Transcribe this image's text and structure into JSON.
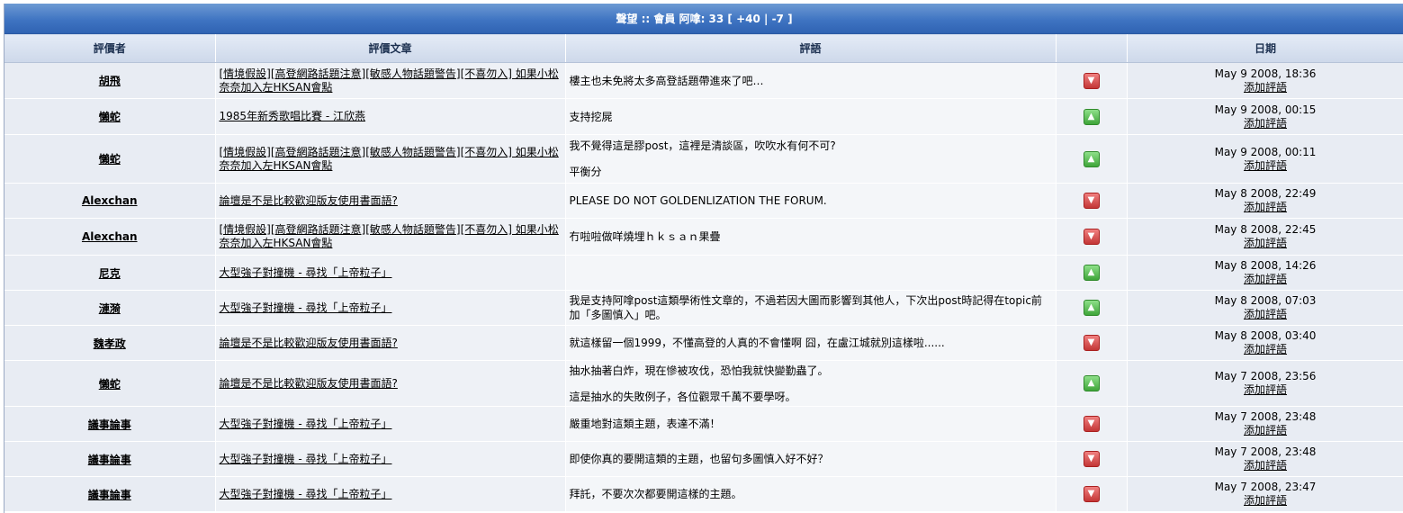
{
  "title": "聲望 :: 會員 阿嗱: 33 [ +40 | -7 ]",
  "headers": {
    "rater": "評價者",
    "article": "評價文章",
    "comment": "評語",
    "rating": "",
    "date": "日期"
  },
  "colors": {
    "up": "#3fa53a",
    "down": "#c33636",
    "header": "#3f74c2"
  },
  "rows": [
    {
      "user": "胡飛",
      "topic": "[情境假設][高登網路話題注意][敏感人物話題警告][不喜勿入] 如果小松奈奈加入左HKSAN會點",
      "comment": [
        "樓主也未免將太多高登話題帶進來了吧…"
      ],
      "rating": "down",
      "rating_icon": "thumb-down-icon",
      "date": "May 9 2008, 18:36",
      "add": "添加評語"
    },
    {
      "user": "懶蛇",
      "topic": "1985年新秀歌唱比賽 - 江欣燕",
      "comment": [
        "支持挖屍"
      ],
      "rating": "up",
      "rating_icon": "thumb-up-icon",
      "date": "May 9 2008, 00:15",
      "add": "添加評語"
    },
    {
      "user": "懶蛇",
      "topic": "[情境假設][高登網路話題注意][敏感人物話題警告][不喜勿入] 如果小松奈奈加入左HKSAN會點",
      "comment": [
        "我不覺得這是膠post，這裡是清談區，吹吹水有何不可?",
        "平衡分"
      ],
      "rating": "up",
      "rating_icon": "thumb-up-icon",
      "date": "May 9 2008, 00:11",
      "add": "添加評語"
    },
    {
      "user": "Alexchan",
      "topic": "論壇是不是比較歡迎版友使用書面語?",
      "comment": [
        "PLEASE DO NOT GOLDENLIZATION THE FORUM."
      ],
      "rating": "down",
      "rating_icon": "thumb-down-icon",
      "date": "May 8 2008, 22:49",
      "add": "添加評語"
    },
    {
      "user": "Alexchan",
      "topic": "[情境假設][高登網路話題注意][敏感人物話題警告][不喜勿入] 如果小松奈奈加入左HKSAN會點",
      "comment": [
        "冇啦啦做咩燒埋ｈｋｓａｎ果疊"
      ],
      "rating": "down",
      "rating_icon": "thumb-down-icon",
      "date": "May 8 2008, 22:45",
      "add": "添加評語"
    },
    {
      "user": "尼克",
      "topic": "大型強子對撞機 - 尋找「上帝粒子」",
      "comment": [],
      "rating": "up",
      "rating_icon": "thumb-up-icon",
      "date": "May 8 2008, 14:26",
      "add": "添加評語"
    },
    {
      "user": "漣漪",
      "topic": "大型強子對撞機 - 尋找「上帝粒子」",
      "comment": [
        "我是支持阿嗱post這類學術性文章的，不過若因大圖而影響到其他人，下次出post時記得在topic前加「多圖慎入」吧。"
      ],
      "rating": "up",
      "rating_icon": "thumb-up-icon",
      "date": "May 8 2008, 07:03",
      "add": "添加評語"
    },
    {
      "user": "魏孝政",
      "topic": "論壇是不是比較歡迎版友使用書面語?",
      "comment": [
        "就這樣留一個1999，不懂高登的人真的不會懂啊 囧，在盧江城就別這樣啦......"
      ],
      "rating": "down",
      "rating_icon": "thumb-down-icon",
      "date": "May 8 2008, 03:40",
      "add": "添加評語"
    },
    {
      "user": "懶蛇",
      "topic": "論壇是不是比較歡迎版友使用書面語?",
      "comment": [
        "抽水抽著白炸，現在慘被攻伐，恐怕我就快變勤蟲了。",
        "這是抽水的失敗例子，各位觀眾千萬不要學呀。"
      ],
      "rating": "up",
      "rating_icon": "thumb-up-icon",
      "date": "May 7 2008, 23:56",
      "add": "添加評語"
    },
    {
      "user": "議事論事",
      "topic": "大型強子對撞機 - 尋找「上帝粒子」",
      "comment": [
        "嚴重地對這類主題，表達不滿！"
      ],
      "rating": "down",
      "rating_icon": "thumb-down-icon",
      "date": "May 7 2008, 23:48",
      "add": "添加評語"
    },
    {
      "user": "議事論事",
      "topic": "大型強子對撞機 - 尋找「上帝粒子」",
      "comment": [
        "即使你真的要開這類的主題，也留句多圖慎入好不好？"
      ],
      "rating": "down",
      "rating_icon": "thumb-down-icon",
      "date": "May 7 2008, 23:48",
      "add": "添加評語"
    },
    {
      "user": "議事論事",
      "topic": "大型強子對撞機 - 尋找「上帝粒子」",
      "comment": [
        "拜託，不要次次都要開這樣的主題。"
      ],
      "rating": "down",
      "rating_icon": "thumb-down-icon",
      "date": "May 7 2008, 23:47",
      "add": "添加評語"
    }
  ]
}
